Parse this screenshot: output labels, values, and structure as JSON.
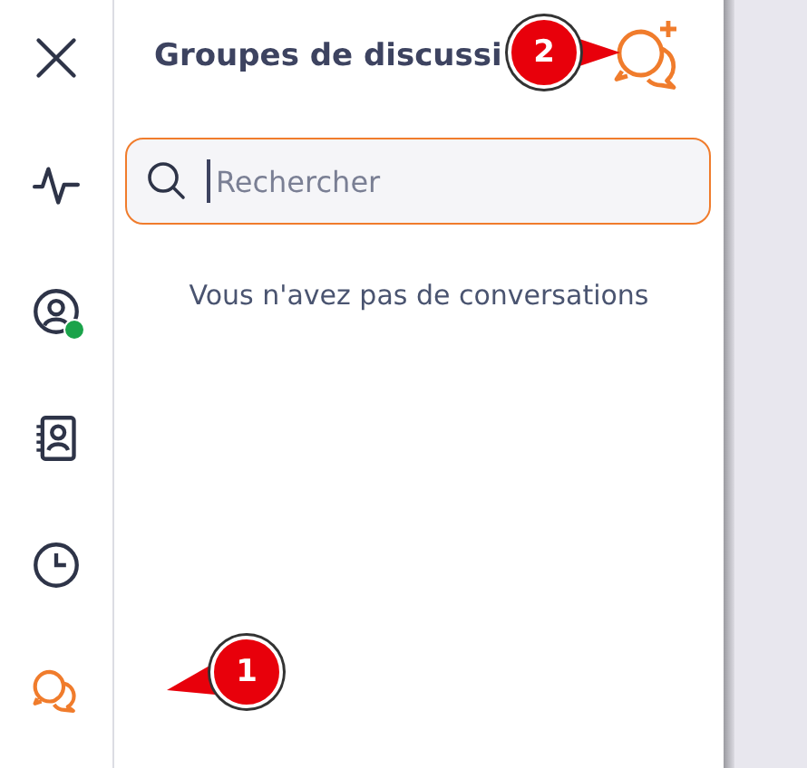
{
  "rail": [
    {
      "kind": "close",
      "selected": false
    },
    {
      "kind": "activity",
      "selected": false
    },
    {
      "kind": "status",
      "selected": false,
      "online": true
    },
    {
      "kind": "contacts",
      "selected": false
    },
    {
      "kind": "history",
      "selected": false
    },
    {
      "kind": "chats",
      "selected": true
    }
  ],
  "panel": {
    "title": "Groupes de discussi",
    "search": {
      "placeholder": "Rechercher"
    },
    "empty_message": "Vous n'avez pas de conversations"
  },
  "callouts": [
    {
      "label": "2",
      "kind": "right"
    },
    {
      "label": "1",
      "kind": "left"
    }
  ]
}
